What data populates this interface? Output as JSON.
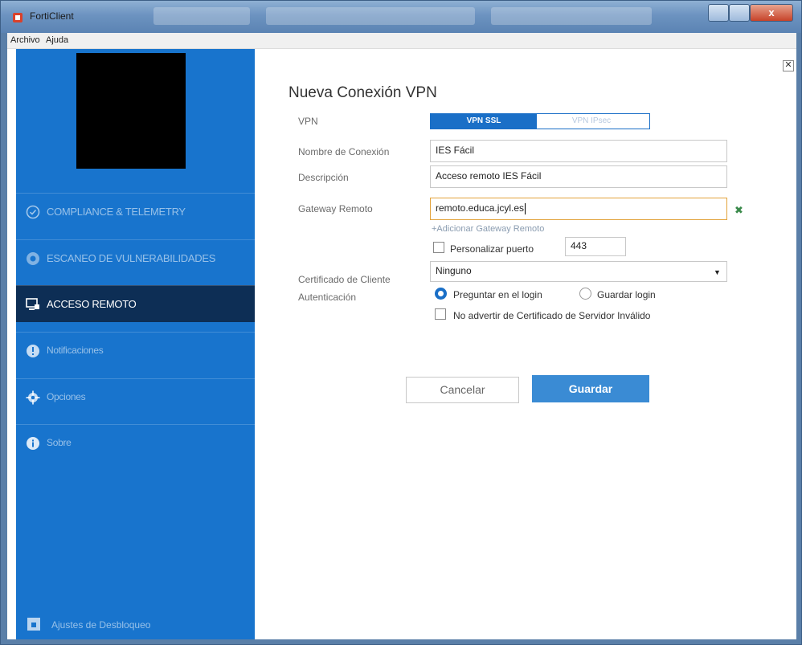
{
  "window": {
    "title": "FortiClient",
    "close_glyph": "x"
  },
  "menu": {
    "items": [
      "Archivo",
      "Ajuda"
    ]
  },
  "sidebar": {
    "nav": [
      {
        "label": "COMPLIANCE & TELEMETRY",
        "icon": "check-circle-icon"
      },
      {
        "label": "ESCANEO DE VULNERABILIDADES",
        "icon": "shield-scan-icon"
      },
      {
        "label": "ACCESO REMOTO",
        "icon": "remote-access-icon",
        "active": true
      },
      {
        "label": "Notificaciones",
        "icon": "alert-icon"
      },
      {
        "label": "Opciones",
        "icon": "gear-icon"
      },
      {
        "label": "Sobre",
        "icon": "info-icon"
      }
    ],
    "unlock_label": "Ajustes de Desbloqueo"
  },
  "form": {
    "title": "Nueva Conexión VPN",
    "close_glyph": "✕",
    "vpn_label": "VPN",
    "vpn_options": [
      "VPN SSL",
      "VPN IPsec"
    ],
    "vpn_selected": "VPN SSL",
    "name_label": "Nombre de Conexión",
    "name_value": "IES Fácil",
    "desc_label": "Descripción",
    "desc_value": "Acceso remoto IES Fácil",
    "gateway_label": "Gateway Remoto",
    "gateway_value": "remoto.educa.jcyl.es",
    "gateway_remove_glyph": "✖",
    "add_gateway": "+Adicionar Gateway Remoto",
    "custom_port_label": "Personalizar puerto",
    "port_value": "443",
    "cert_label": "Certificado de Cliente",
    "cert_value": "Ninguno",
    "auth_label": "Autenticación",
    "auth_option_1": "Preguntar en el login",
    "auth_option_2": "Guardar login",
    "auth_selected": "Preguntar en el login",
    "no_warn_label": "No advertir de Certificado de Servidor Inválido",
    "cancel_label": "Cancelar",
    "save_label": "Guardar"
  },
  "colors": {
    "sidebar": "#1874cd",
    "active_nav": "#0d2e55",
    "accent": "#1a6fc7",
    "save_button": "#3a8bd4"
  }
}
